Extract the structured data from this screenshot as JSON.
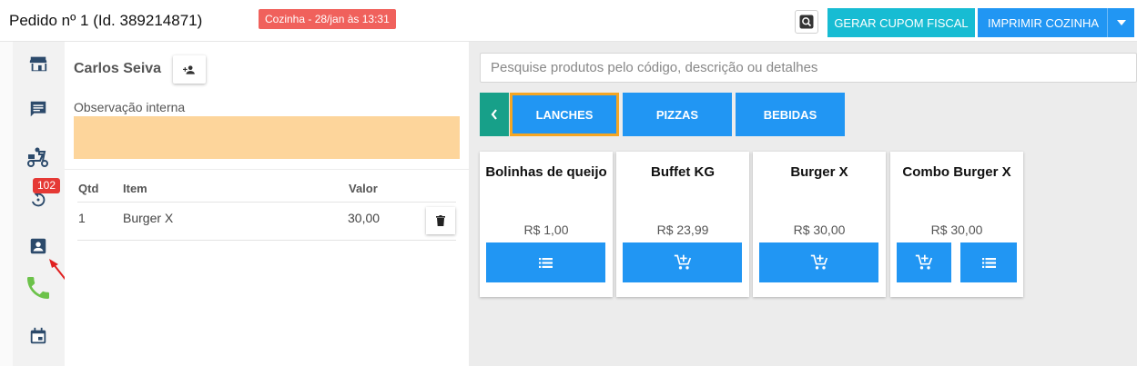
{
  "header": {
    "order_title": "Pedido nº 1 (Id. 389214871)",
    "kitchen_badge": "Cozinha - 28/jan às 13:31",
    "cupom_button": "GERAR CUPOM FISCAL",
    "print_button": "IMPRIMIR COZINHA"
  },
  "sidebar": {
    "items": [
      {
        "icon": "store-icon"
      },
      {
        "icon": "message-icon"
      },
      {
        "icon": "delivery-scooter-icon"
      },
      {
        "icon": "history-icon",
        "badge": "102"
      },
      {
        "icon": "contact-card-icon"
      },
      {
        "icon": "phone-icon"
      },
      {
        "icon": "calendar-icon"
      }
    ],
    "phone_color": "#6cc24a"
  },
  "order": {
    "customer": "Carlos Seiva",
    "obs_label": "Observação interna",
    "obs_color": "#fdd59b",
    "columns": {
      "qtd": "Qtd",
      "item": "Item",
      "valor": "Valor"
    },
    "rows": [
      {
        "qtd": "1",
        "item": "Burger X",
        "valor": "30,00"
      }
    ]
  },
  "catalog": {
    "search_placeholder": "Pesquise produtos pelo código, descrição ou detalhes",
    "categories": [
      {
        "label": "LANCHES",
        "active": true
      },
      {
        "label": "PIZZAS",
        "active": false
      },
      {
        "label": "BEBIDAS",
        "active": false
      }
    ],
    "products": [
      {
        "name": "Bolinhas de queijo",
        "price": "R$ 1,00",
        "buttons": [
          "list"
        ]
      },
      {
        "name": "Buffet KG",
        "price": "R$ 23,99",
        "buttons": [
          "add-cart"
        ]
      },
      {
        "name": "Burger X",
        "price": "R$ 30,00",
        "buttons": [
          "add-cart"
        ]
      },
      {
        "name": "Combo Burger X",
        "price": "R$ 30,00",
        "buttons": [
          "add-cart",
          "list"
        ]
      }
    ]
  },
  "colors": {
    "primary": "#2196f3",
    "cyan": "#17bcd3",
    "teal": "#17a089",
    "badge_red": "#f0615c",
    "active_border": "#f5a623"
  }
}
